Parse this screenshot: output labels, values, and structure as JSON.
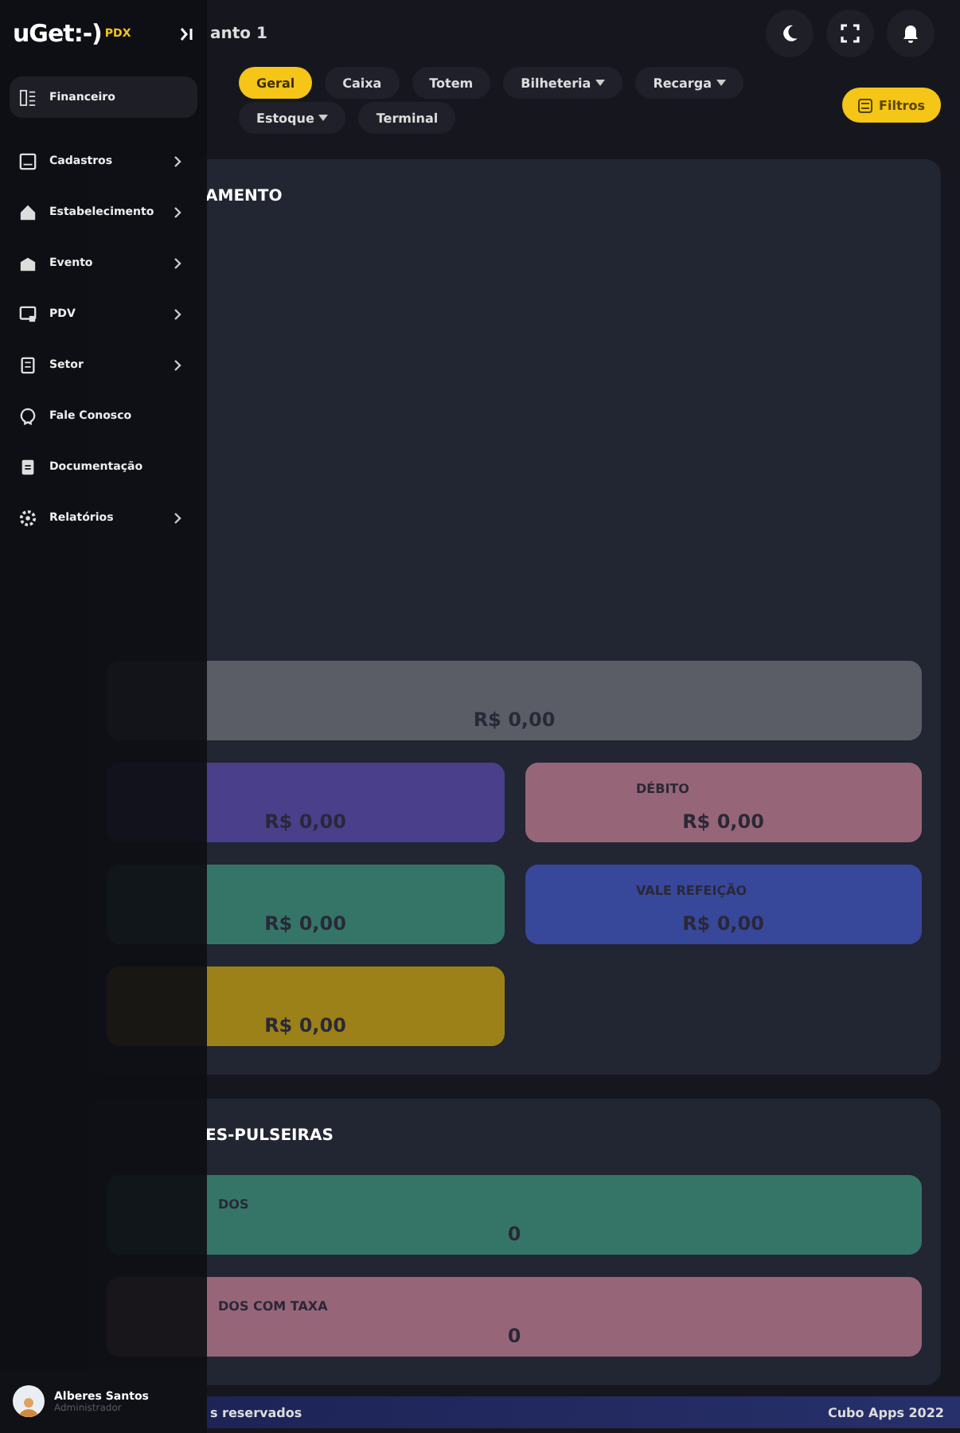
{
  "top_bar": {
    "logo": "uGet:-)",
    "logo_badge": "PDX",
    "event": "anto 1"
  },
  "tabs": [
    {
      "label": "Geral",
      "selected": true,
      "dropdown": false
    },
    {
      "label": "Caixa",
      "selected": false,
      "dropdown": false
    },
    {
      "label": "Totem",
      "selected": false,
      "dropdown": false
    },
    {
      "label": "Bilheteria",
      "selected": false,
      "dropdown": true
    },
    {
      "label": "Recarga",
      "selected": false,
      "dropdown": true
    },
    {
      "label": "Estoque",
      "selected": false,
      "dropdown": true
    },
    {
      "label": "Terminal",
      "selected": false,
      "dropdown": false
    }
  ],
  "filter_button": "Filtros",
  "sections": [
    {
      "title": "AMENTO",
      "cards": [
        {
          "kind": "wide",
          "value": "R$ 0,00",
          "color": "#5a5d66"
        },
        {
          "kind": "half",
          "value": "R$ 0,00",
          "color": "#4a3f8a"
        },
        {
          "kind": "half",
          "label": "DÉBITO",
          "value": "R$ 0,00",
          "color": "#966678"
        },
        {
          "kind": "half",
          "value": "R$ 0,00",
          "color": "#357567"
        },
        {
          "kind": "half",
          "label": "VALE REFEIÇÃO",
          "value": "R$ 0,00",
          "color": "#37479a"
        },
        {
          "kind": "half",
          "value": "R$ 0,00",
          "color": "#9b8118"
        }
      ]
    },
    {
      "title": "ES-PULSEIRAS",
      "cards": [
        {
          "kind": "wide",
          "label": "DOS",
          "value": "0",
          "color": "#357567"
        },
        {
          "kind": "wide",
          "label": "DOS COM TAXA",
          "value": "0",
          "color": "#966678"
        }
      ]
    }
  ],
  "sidebar": {
    "items": [
      {
        "label": "Financeiro",
        "selected": true,
        "has_submenu": false
      },
      {
        "label": "Cadastros",
        "selected": false,
        "has_submenu": true
      },
      {
        "label": "Estabelecimento",
        "selected": false,
        "has_submenu": true
      },
      {
        "label": "Evento",
        "selected": false,
        "has_submenu": true
      },
      {
        "label": "PDV",
        "selected": false,
        "has_submenu": true
      },
      {
        "label": "Setor",
        "selected": false,
        "has_submenu": true
      },
      {
        "label": "Fale Conosco",
        "selected": false,
        "has_submenu": false
      },
      {
        "label": "Documentação",
        "selected": false,
        "has_submenu": false
      },
      {
        "label": "Relatórios",
        "selected": false,
        "has_submenu": true
      }
    ],
    "user": {
      "name": "Alberes Santos",
      "role": "Administrador"
    }
  },
  "footer": {
    "left": "s reservados",
    "right": "Cubo Apps 2022"
  }
}
